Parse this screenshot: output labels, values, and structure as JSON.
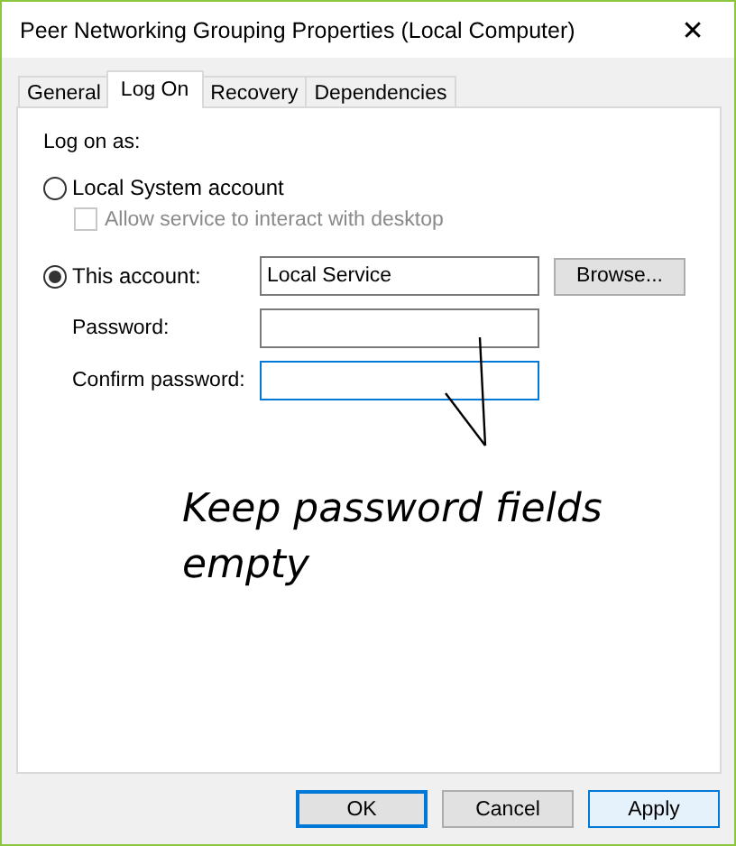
{
  "window": {
    "title": "Peer Networking Grouping Properties (Local Computer)",
    "close": "✕"
  },
  "tabs": [
    {
      "label": "General",
      "selected": false
    },
    {
      "label": "Log On",
      "selected": true
    },
    {
      "label": "Recovery",
      "selected": false
    },
    {
      "label": "Dependencies",
      "selected": false
    }
  ],
  "log_on_as": "Log on as:",
  "local_system": {
    "label": "Local System account",
    "selected": false
  },
  "interact_checkbox": {
    "label": "Allow service to interact with desktop",
    "checked": false,
    "disabled": true
  },
  "this_account": {
    "label": "This account:",
    "selected": true,
    "value": "Local Service",
    "browse": "Browse..."
  },
  "password": {
    "label": "Password:",
    "focused": false
  },
  "confirm_password": {
    "label": "Confirm password:",
    "focused": true
  },
  "annotation": "Keep password fields empty",
  "buttons": [
    {
      "label": "OK",
      "default": true,
      "hover": false
    },
    {
      "label": "Cancel",
      "default": false,
      "hover": false
    },
    {
      "label": "Apply",
      "default": false,
      "hover": true
    }
  ]
}
